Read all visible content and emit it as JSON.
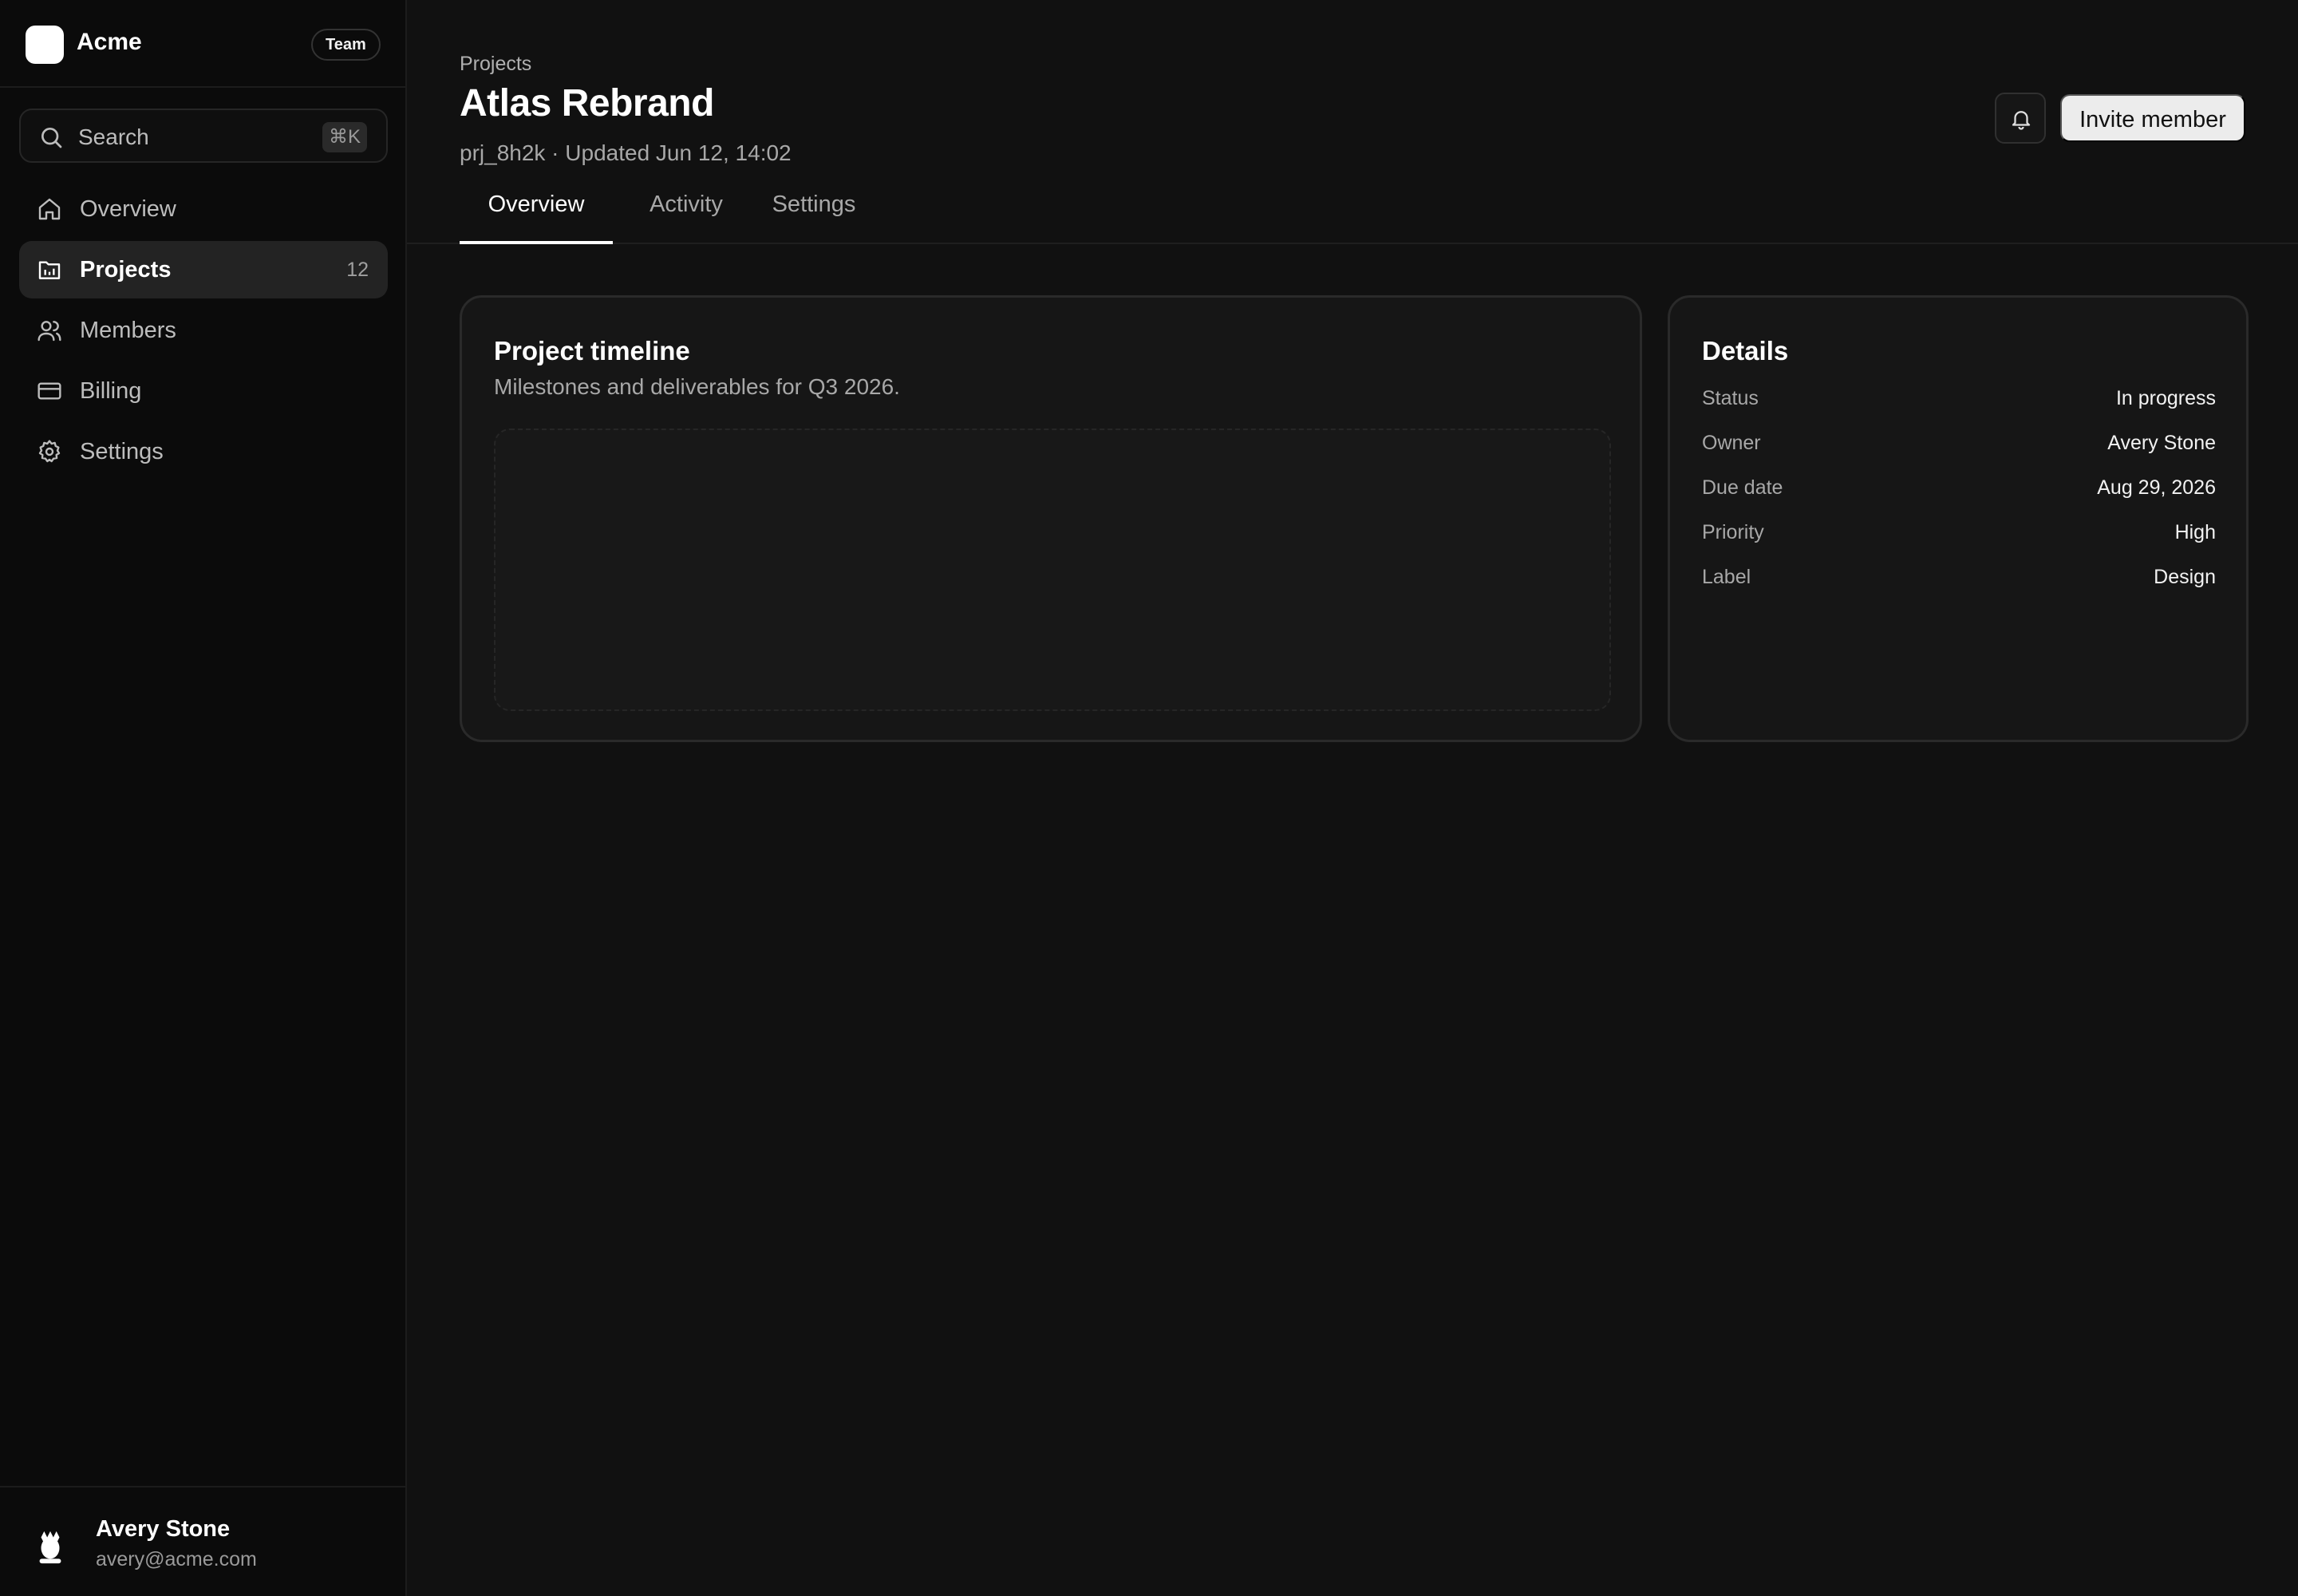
{
  "brand": {
    "name": "Acme",
    "badge": "Team"
  },
  "search": {
    "label": "Search",
    "shortcut": "⌘K"
  },
  "sidebar": {
    "items": [
      {
        "label": "Overview",
        "icon": "home-icon"
      },
      {
        "label": "Projects",
        "icon": "folder-icon",
        "count": "12",
        "active": true
      },
      {
        "label": "Members",
        "icon": "users-icon"
      },
      {
        "label": "Billing",
        "icon": "credit-card-icon"
      },
      {
        "label": "Settings",
        "icon": "gear-icon"
      }
    ]
  },
  "user": {
    "name": "Avery Stone",
    "email": "avery@acme.com"
  },
  "header": {
    "breadcrumb": "Projects",
    "title": "Atlas Rebrand",
    "meta": "prj_8h2k · Updated Jun 12, 14:02",
    "invite_label": "Invite member"
  },
  "tabs": [
    {
      "label": "Overview",
      "active": true
    },
    {
      "label": "Activity"
    },
    {
      "label": "Settings"
    }
  ],
  "timeline": {
    "title": "Project timeline",
    "subtitle": "Milestones and deliverables for Q3 2026."
  },
  "details": {
    "title": "Details",
    "rows": [
      {
        "key": "Status",
        "value": "In progress"
      },
      {
        "key": "Owner",
        "value": "Avery Stone"
      },
      {
        "key": "Due date",
        "value": "Aug 29, 2026"
      },
      {
        "key": "Priority",
        "value": "High"
      },
      {
        "key": "Label",
        "value": "Design"
      }
    ]
  },
  "colors": {
    "background": "#111111",
    "sidebar": "#0b0b0b",
    "card": "#161616",
    "active_nav": "#232323",
    "primary_button": "#ececec"
  }
}
